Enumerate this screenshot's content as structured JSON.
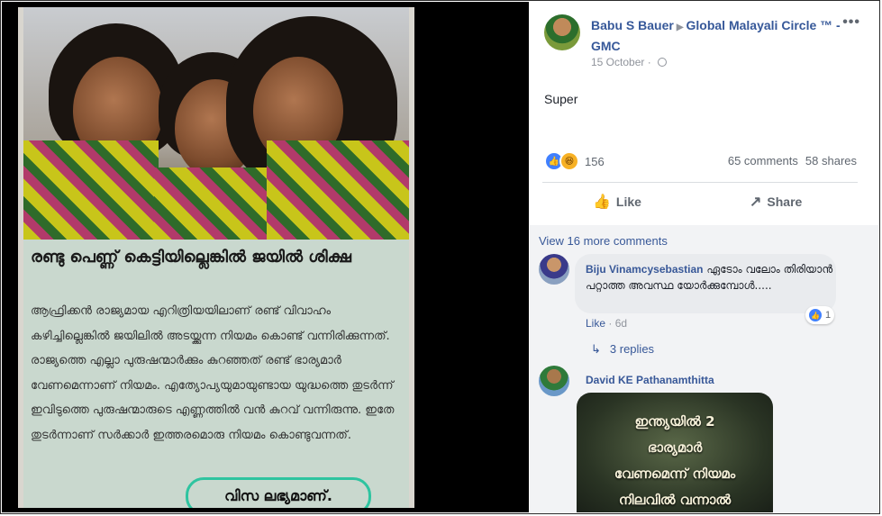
{
  "clipping": {
    "headline": "രണ്ടു പെണ്ണ് കെട്ടിയില്ലെങ്കിൽ ജയിൽ ശിക്ഷ",
    "body": "ആഫ്രിക്കൻ രാജ്യമായ എറിത്രിയയിലാണ് രണ്ട് വിവാഹം കഴിച്ചില്ലെങ്കിൽ ജയിലിൽ അടയ്ക്കുന്ന നിയമം കൊണ്ട് വന്നിരിക്കുന്നത്. രാജ്യത്തെ എല്ലാ പുരുഷന്മാർക്കും കുറഞ്ഞത് രണ്ട് ഭാര്യമാർ വേണമെന്നാണ് നിയമം. എത്യോപ്യയുമായുണ്ടായ യുദ്ധത്തെ തുടർന്ന് ഇവിടുത്തെ പുരുഷന്മാരുടെ എണ്ണത്തിൽ വൻ കുറവ് വന്നിരുന്നു. ഇതേ തുടർന്നാണ് സർക്കാർ ഇത്തരമൊരു നിയമം കൊണ്ടുവന്നത്.",
    "highlight": "വിസ ലഭ്യമാണ്."
  },
  "post": {
    "author": "Babu S Bauer",
    "group": "Global Malayali Circle ™ - GMC",
    "date": "15 October",
    "text": "Super",
    "reaction_count": "156",
    "comments": "65 comments",
    "shares": "58 shares",
    "like_label": "Like",
    "share_label": "Share",
    "more_label": "•••"
  },
  "comments": {
    "view_more": "View 16 more comments",
    "c1": {
      "name": "Biju Vinamcysebastian",
      "text": "ഏടോം വലോം തിരിയാൻ പറ്റാത്ത അവസ്ഥ യോർക്കുമ്പോൾ.....",
      "like": "Like",
      "time": "6d",
      "reactions": "1",
      "replies": "3 replies"
    },
    "c2": {
      "name": "David KE Pathanamthitta",
      "sticker_lines": [
        "ഇന്ത്യയിൽ 2",
        "ഭാര്യമാർ",
        "വേണമെന്ന് നിയമം",
        "നിലവിൽ വന്നാൽ"
      ]
    }
  },
  "colors": {
    "link": "#385898",
    "name": "#365899",
    "muted": "#606770",
    "like_blue": "#4080ff",
    "haha_yellow": "#f7b125"
  },
  "icons": [
    "more-dots-icon",
    "globe-icon",
    "like-reaction-icon",
    "haha-reaction-icon",
    "thumbs-up-icon",
    "share-arrow-icon",
    "reply-arrow-icon"
  ]
}
